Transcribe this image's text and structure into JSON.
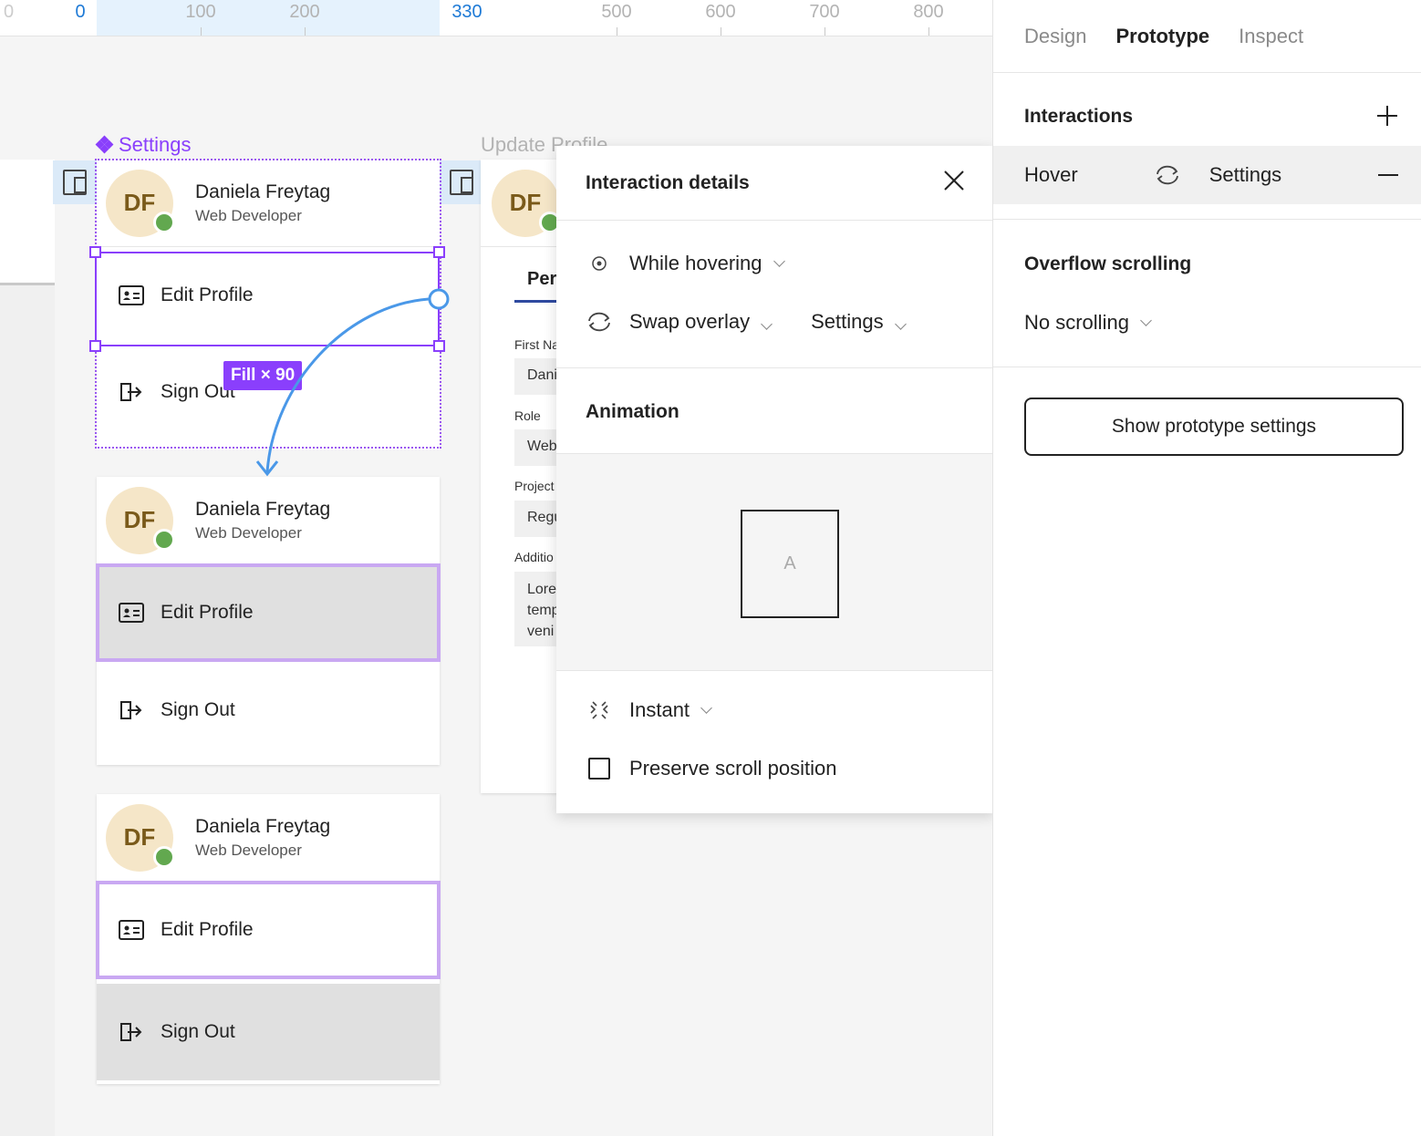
{
  "ruler": {
    "marks": [
      {
        "label": "0",
        "active": true
      },
      {
        "label": "100",
        "active": false
      },
      {
        "label": "200",
        "active": false
      },
      {
        "label": "330",
        "active": true
      },
      {
        "label": "500",
        "active": false
      },
      {
        "label": "600",
        "active": false
      },
      {
        "label": "700",
        "active": false
      },
      {
        "label": "800",
        "active": false
      }
    ],
    "edge_label": "0"
  },
  "canvas": {
    "settings_frame_label": "Settings",
    "update_frame_label": "Update Profile",
    "fill_badge": "Fill × 90",
    "cards": [
      {
        "avatar": "DF",
        "name": "Daniela Freytag",
        "role": "Web Developer",
        "edit": "Edit Profile",
        "signout": "Sign Out"
      },
      {
        "avatar": "DF",
        "name": "Daniela Freytag",
        "role": "Web Developer",
        "edit": "Edit Profile",
        "signout": "Sign Out"
      },
      {
        "avatar": "DF",
        "name": "Daniela Freytag",
        "role": "Web Developer",
        "edit": "Edit Profile",
        "signout": "Sign Out"
      }
    ],
    "update_profile": {
      "avatar": "DF",
      "tab": "Per",
      "fields": [
        {
          "label": "First Na",
          "value": "Dani"
        },
        {
          "label": "Role",
          "value": "Web"
        },
        {
          "label": "Project",
          "value": "Regu"
        }
      ],
      "additional_label": "Additio",
      "additional_lines": [
        "Lore",
        "temp",
        "veni"
      ]
    }
  },
  "popover": {
    "title": "Interaction details",
    "trigger": "While hovering",
    "action": "Swap overlay",
    "destination": "Settings",
    "animation_title": "Animation",
    "preview_letter": "A",
    "transition": "Instant",
    "preserve_scroll": "Preserve scroll position"
  },
  "panel": {
    "tabs": [
      {
        "label": "Design",
        "active": false
      },
      {
        "label": "Prototype",
        "active": true
      },
      {
        "label": "Inspect",
        "active": false
      }
    ],
    "interactions_title": "Interactions",
    "interaction": {
      "trigger": "Hover",
      "target": "Settings"
    },
    "overflow_title": "Overflow scrolling",
    "overflow_value": "No scrolling",
    "settings_button": "Show prototype settings"
  },
  "colors": {
    "component_purple": "#8a3ffc",
    "ruler_active": "#1e7ad6",
    "prototype_arrow": "#4a98e8",
    "status_green": "#62a84f"
  }
}
